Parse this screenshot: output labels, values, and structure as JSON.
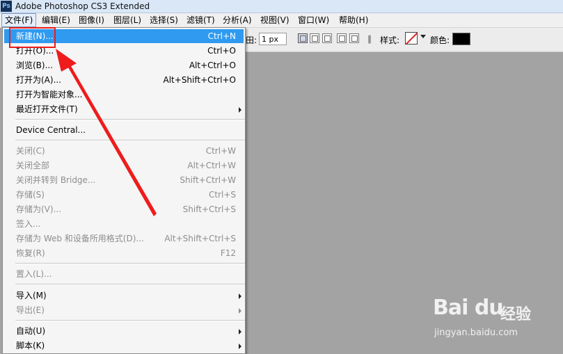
{
  "window": {
    "app_icon": "Ps",
    "title": "Adobe Photoshop CS3 Extended"
  },
  "menubar": [
    {
      "label": "文件(F)",
      "active": true
    },
    {
      "label": "编辑(E)"
    },
    {
      "label": "图像(I)"
    },
    {
      "label": "图层(L)"
    },
    {
      "label": "选择(S)"
    },
    {
      "label": "滤镜(T)"
    },
    {
      "label": "分析(A)"
    },
    {
      "label": "视图(V)"
    },
    {
      "label": "窗口(W)"
    },
    {
      "label": "帮助(H)"
    }
  ],
  "options_bar": {
    "feather_partial_label": "田:",
    "feather_value": "1 px",
    "style_label": "样式:",
    "color_label": "颜色:",
    "color_value": "#000000",
    "icons": [
      "new-selection-icon",
      "add-selection-icon",
      "subtract-selection-icon",
      "intersect-selection-icon",
      "anti-alias-icon",
      "paperclip-icon",
      "no-style-swatch-icon",
      "dropdown-arrow-icon"
    ]
  },
  "file_menu": {
    "items": [
      {
        "label": "新建(N)...",
        "shortcut": "Ctrl+N",
        "highlighted": true
      },
      {
        "label": "打开(O)...",
        "shortcut": "Ctrl+O"
      },
      {
        "label": "浏览(B)...",
        "shortcut": "Alt+Ctrl+O"
      },
      {
        "label": "打开为(A)...",
        "shortcut": "Alt+Shift+Ctrl+O"
      },
      {
        "label": "打开为智能对象..."
      },
      {
        "label": "最近打开文件(T)",
        "submenu": true
      },
      {
        "label": "Device Central..."
      },
      {
        "label": "关闭(C)",
        "shortcut": "Ctrl+W",
        "disabled": true
      },
      {
        "label": "关闭全部",
        "shortcut": "Alt+Ctrl+W",
        "disabled": true
      },
      {
        "label": "关闭并转到 Bridge...",
        "shortcut": "Shift+Ctrl+W",
        "disabled": true
      },
      {
        "label": "存储(S)",
        "shortcut": "Ctrl+S",
        "disabled": true
      },
      {
        "label": "存储为(V)...",
        "shortcut": "Shift+Ctrl+S",
        "disabled": true
      },
      {
        "label": "签入...",
        "disabled": true
      },
      {
        "label": "存储为 Web 和设备所用格式(D)...",
        "shortcut": "Alt+Shift+Ctrl+S",
        "disabled": true
      },
      {
        "label": "恢复(R)",
        "shortcut": "F12",
        "disabled": true
      },
      {
        "label": "置入(L)...",
        "disabled": true
      },
      {
        "label": "导入(M)",
        "submenu": true
      },
      {
        "label": "导出(E)",
        "submenu": true,
        "disabled": true
      },
      {
        "label": "自动(U)",
        "submenu": true
      },
      {
        "label": "脚本(K)",
        "submenu": true
      }
    ]
  },
  "annotation": {
    "color": "#ee1c1c"
  },
  "watermark": {
    "logo": "Bai du",
    "brand": "经验",
    "url": "jingyan.baidu.com"
  }
}
